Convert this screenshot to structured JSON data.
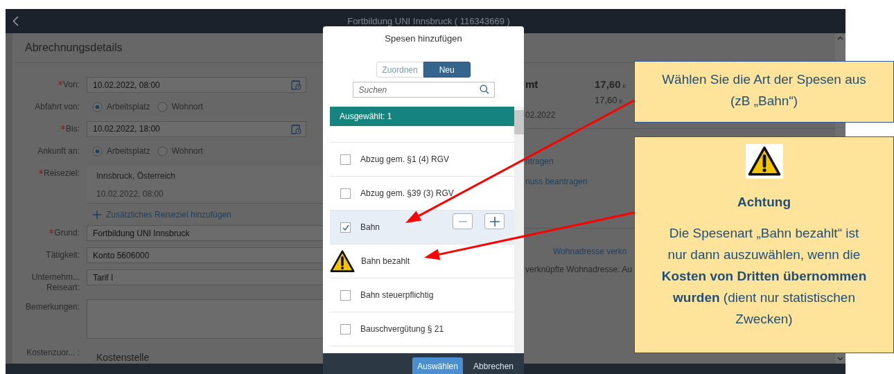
{
  "app_bar": {
    "title": "Fortbildung UNI Innsbruck ( 116343669 )"
  },
  "details": {
    "title": "Abrechnungsdetails",
    "fields": [
      {
        "kind": "date",
        "label": "Von:",
        "required": true,
        "value": "10.02.2022, 08:00"
      },
      {
        "kind": "radio",
        "label": "Abfahrt von:",
        "required": false,
        "options": [
          {
            "label": "Arbeitsplatz",
            "selected": true
          },
          {
            "label": "Wohnort",
            "selected": false
          }
        ]
      },
      {
        "kind": "date",
        "label": "Bis:",
        "required": true,
        "value": "10.02.2022, 18:00"
      },
      {
        "kind": "radio",
        "label": "Ankunft an:",
        "required": false,
        "options": [
          {
            "label": "Arbeitsplatz",
            "selected": true
          },
          {
            "label": "Wohnort",
            "selected": false
          }
        ]
      },
      {
        "kind": "destination",
        "label": "Reiseziel:",
        "required": true,
        "place": "Innsbruck, Österreich",
        "time": "10.02.2022, 08:00"
      },
      {
        "kind": "add-link",
        "text": "Zusätzliches Reiseziel hinzufügen"
      },
      {
        "kind": "text",
        "label": "Grund:",
        "required": true,
        "value": "Fortbildung UNI Innsbruck"
      },
      {
        "kind": "text",
        "label": "Tätigkeit:",
        "required": false,
        "value": "Konto 5606000"
      },
      {
        "kind": "text",
        "label": "Unternehm... Reiseart:",
        "required": false,
        "value": "Tarif I"
      },
      {
        "kind": "textarea",
        "label": "Bemerkungen:",
        "required": false
      },
      {
        "kind": "section",
        "label": "Kostenzuor... :",
        "required": false,
        "value": "Kostenstelle"
      }
    ]
  },
  "summary": {
    "total_label": "mt",
    "total_amount": "17,60",
    "total_currency": "E",
    "amount": "17,60",
    "currency": "E",
    "date": "02.2022",
    "links": [
      "ntragen",
      "nuss beantragen"
    ],
    "address_link": "Wohnadresse verkn",
    "address_text": "verknüpfte Wohnadresse: Au"
  },
  "dialog": {
    "title": "Spesen hinzufügen",
    "segments": [
      {
        "label": "Zuordnen",
        "selected": false
      },
      {
        "label": "Neu",
        "selected": true
      }
    ],
    "search": {
      "placeholder": "Suchen"
    },
    "selected_info": "Ausgewählt: 1",
    "items": [
      {
        "kind": "checkbox",
        "label": "Abzug gem. §1 (4) RGV",
        "checked": false
      },
      {
        "kind": "checkbox",
        "label": "Abzug gem. §39 (3) RGV",
        "checked": false
      },
      {
        "kind": "checkbox",
        "label": "Bahn",
        "checked": true
      },
      {
        "kind": "warning",
        "label": "Bahn bezahlt",
        "checked": false
      },
      {
        "kind": "checkbox",
        "label": "Bahn steuerpflichtig",
        "checked": false
      },
      {
        "kind": "checkbox",
        "label": "Bauschvergütung § 21",
        "checked": false
      }
    ],
    "buttons": [
      {
        "label": "Auswählen",
        "kind": "primary"
      },
      {
        "label": "Abbrechen",
        "kind": "plain"
      }
    ]
  },
  "callouts": [
    {
      "kind": "note",
      "text": "Wählen Sie die Art der Spesen aus (zB „Bahn“)"
    },
    {
      "kind": "warning",
      "title": "Achtung",
      "text": "Die Spesenart „Bahn bezahlt“ ist nur dann auszuwählen, wenn die **Kosten von Dritten übernommen wurden** (dient nur statistischen Zwecken)"
    }
  ]
}
